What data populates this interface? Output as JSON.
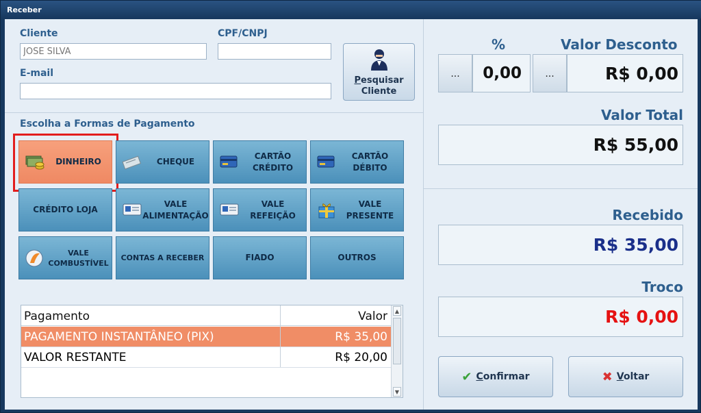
{
  "window": {
    "title": "Receber"
  },
  "client": {
    "label": "Cliente",
    "value": "JOSÉ SILVA",
    "cpf_label": "CPF/CNPJ",
    "cpf_value": "",
    "email_label": "E-mail",
    "email_value": ""
  },
  "search_button": {
    "line1_u": "P",
    "line1_rest": "esquisar",
    "line2": "Cliente"
  },
  "payment": {
    "section_label": "Escolha a Formas de Pagamento",
    "methods": [
      {
        "label": "DINHEIRO",
        "icon": "cash-icon"
      },
      {
        "label": "CHEQUE",
        "icon": "check-icon"
      },
      {
        "label": "CARTÃO CRÉDITO",
        "icon": "credit-card-icon"
      },
      {
        "label": "CARTÃO DÉBITO",
        "icon": "debit-card-icon"
      },
      {
        "label": "CRÉDITO LOJA",
        "icon": ""
      },
      {
        "label": "VALE ALIMENTAÇÃO",
        "icon": "voucher-icon"
      },
      {
        "label": "VALE REFEIÇÃO",
        "icon": "voucher-icon"
      },
      {
        "label": "VALE PRESENTE",
        "icon": "gift-icon"
      },
      {
        "label": "VALE COMBUSTÍVEL",
        "icon": "fuel-icon"
      },
      {
        "label": "CONTAS A RECEBER",
        "icon": ""
      },
      {
        "label": "FIADO",
        "icon": ""
      },
      {
        "label": "OUTROS",
        "icon": ""
      }
    ]
  },
  "grid": {
    "columns": [
      "Pagamento",
      "Valor"
    ],
    "rows": [
      {
        "pagamento": "PAGAMENTO INSTANTÂNEO (PIX)",
        "valor": "R$ 35,00"
      },
      {
        "pagamento": "VALOR RESTANTE",
        "valor": "R$ 20,00"
      }
    ]
  },
  "summary": {
    "percent_label": "%",
    "dots": "...",
    "percent_value": "0,00",
    "discount_label": "Valor Desconto",
    "discount_value": "R$ 0,00",
    "total_label": "Valor Total",
    "total_value": "R$ 55,00",
    "received_label": "Recebido",
    "received_value": "R$ 35,00",
    "change_label": "Troco",
    "change_value": "R$ 0,00"
  },
  "actions": {
    "confirm_u": "C",
    "confirm_rest": "onfirmar",
    "back_u": "V",
    "back_rest": "oltar"
  },
  "colors": {
    "accent_blue": "#2e5f8e",
    "selected_orange": "#ef8963",
    "received_navy": "#1a2f8a",
    "change_red": "#e51212"
  }
}
